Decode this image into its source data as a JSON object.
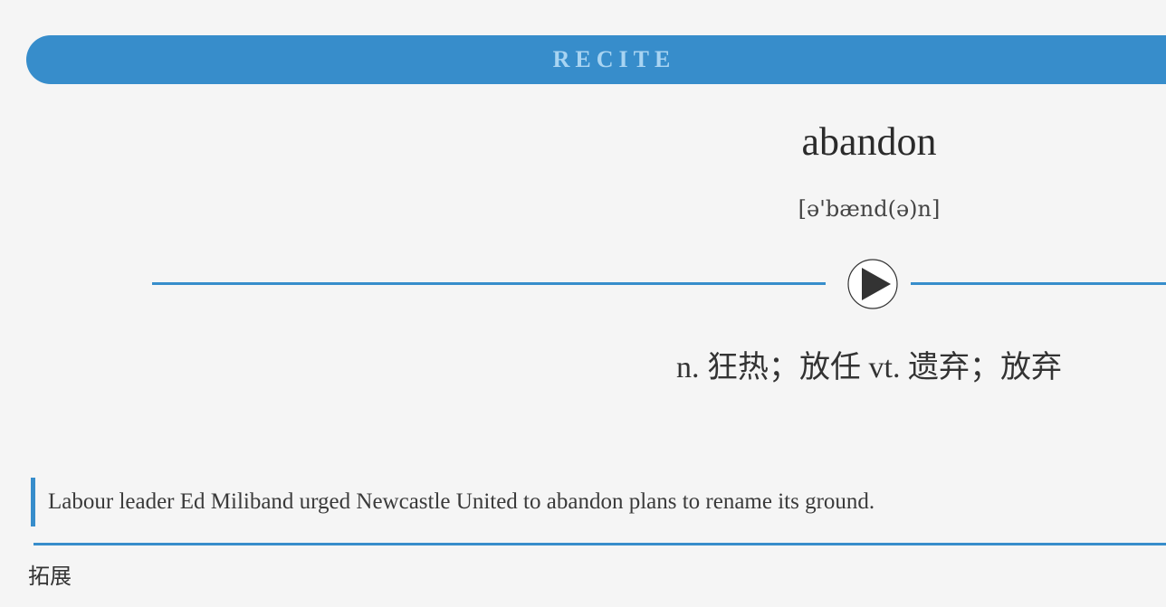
{
  "header": {
    "title": "RECITE"
  },
  "word": {
    "text": "abandon",
    "phonetic": "[ə'bænd(ə)n]",
    "definition": "n. 狂热；放任 vt. 遗弃；放弃"
  },
  "audio": {
    "icon": "play-icon"
  },
  "example": {
    "sentence": "Labour leader Ed Miliband urged Newcastle United to abandon plans to rename its ground."
  },
  "expand": {
    "label": "拓展"
  },
  "colors": {
    "accent": "#378dcb",
    "header_text": "#a8d4f2",
    "background": "#f5f5f5"
  }
}
